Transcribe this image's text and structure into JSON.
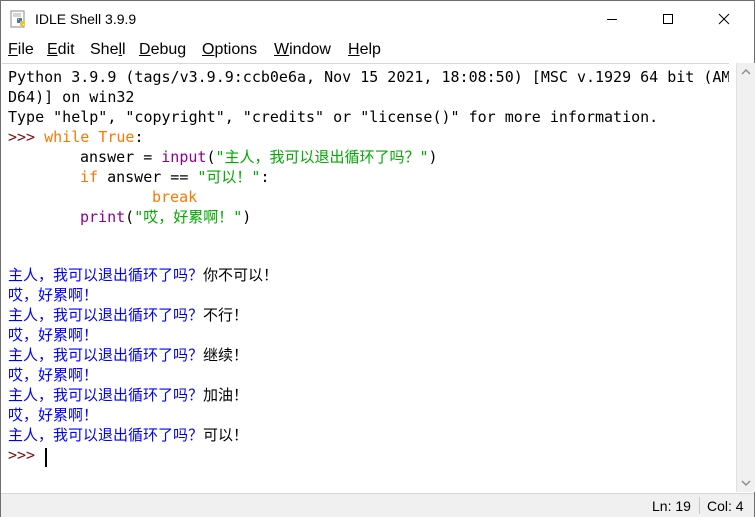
{
  "window": {
    "title": "IDLE Shell 3.9.9",
    "app_icon": "python-idle-icon",
    "controls": [
      "minimize-icon",
      "maximize-icon",
      "close-icon"
    ]
  },
  "menu": {
    "items": [
      {
        "label": "File",
        "underline": "F",
        "rest": "ile"
      },
      {
        "label": "Edit",
        "underline": "E",
        "rest": "dit"
      },
      {
        "label": "Shell",
        "pre": "She",
        "underline": "l",
        "rest": "l"
      },
      {
        "label": "Debug",
        "underline": "D",
        "rest": "ebug"
      },
      {
        "label": "Options",
        "underline": "O",
        "rest": "ptions"
      },
      {
        "label": "Window",
        "underline": "W",
        "rest": "indow"
      },
      {
        "label": "Help",
        "underline": "H",
        "rest": "elp"
      }
    ]
  },
  "shell": {
    "banner_line1": "Python 3.9.9 (tags/v3.9.9:ccb0e6a, Nov 15 2021, 18:08:50) [MSC v.1929 64 bit (AM",
    "banner_line2": "D64)] on win32",
    "banner_line3": "Type \"help\", \"copyright\", \"credits\" or \"license()\" for more information.",
    "prompt": ">>> ",
    "code": {
      "while_kw": "while",
      "true_kw": "True",
      "while_colon": ":",
      "answer_assign": "answer = ",
      "input_builtin": "input",
      "input_open": "(",
      "input_str": "\"主人，我可以退出循环了吗？\"",
      "input_close": ")",
      "if_kw": "if",
      "if_cond": " answer == ",
      "if_str": "\"可以！\"",
      "if_colon": ":",
      "break_kw": "break",
      "print_builtin": "print",
      "print_open": "(",
      "print_str": "\"哎，好累啊！\"",
      "print_close": ")"
    },
    "session": [
      {
        "prompt_text": "主人，我可以退出循环了吗？",
        "reply": "你不可以！"
      },
      {
        "output": "哎，好累啊！"
      },
      {
        "prompt_text": "主人，我可以退出循环了吗？",
        "reply": "不行！"
      },
      {
        "output": "哎，好累啊！"
      },
      {
        "prompt_text": "主人，我可以退出循环了吗？",
        "reply": "继续！"
      },
      {
        "output": "哎，好累啊！"
      },
      {
        "prompt_text": "主人，我可以退出循环了吗？",
        "reply": "加油！"
      },
      {
        "output": "哎，好累啊！"
      },
      {
        "prompt_text": "主人，我可以退出循环了吗？",
        "reply": "可以！"
      }
    ],
    "final_prompt": ">>> "
  },
  "status": {
    "line": "Ln: 19",
    "col": "Col: 4"
  },
  "colors": {
    "prompt": "#7a1010",
    "keyword": "#ff7700",
    "builtin": "#900090",
    "string": "#00aa00",
    "stdout": "#0000ff",
    "stdin": "#000000"
  }
}
